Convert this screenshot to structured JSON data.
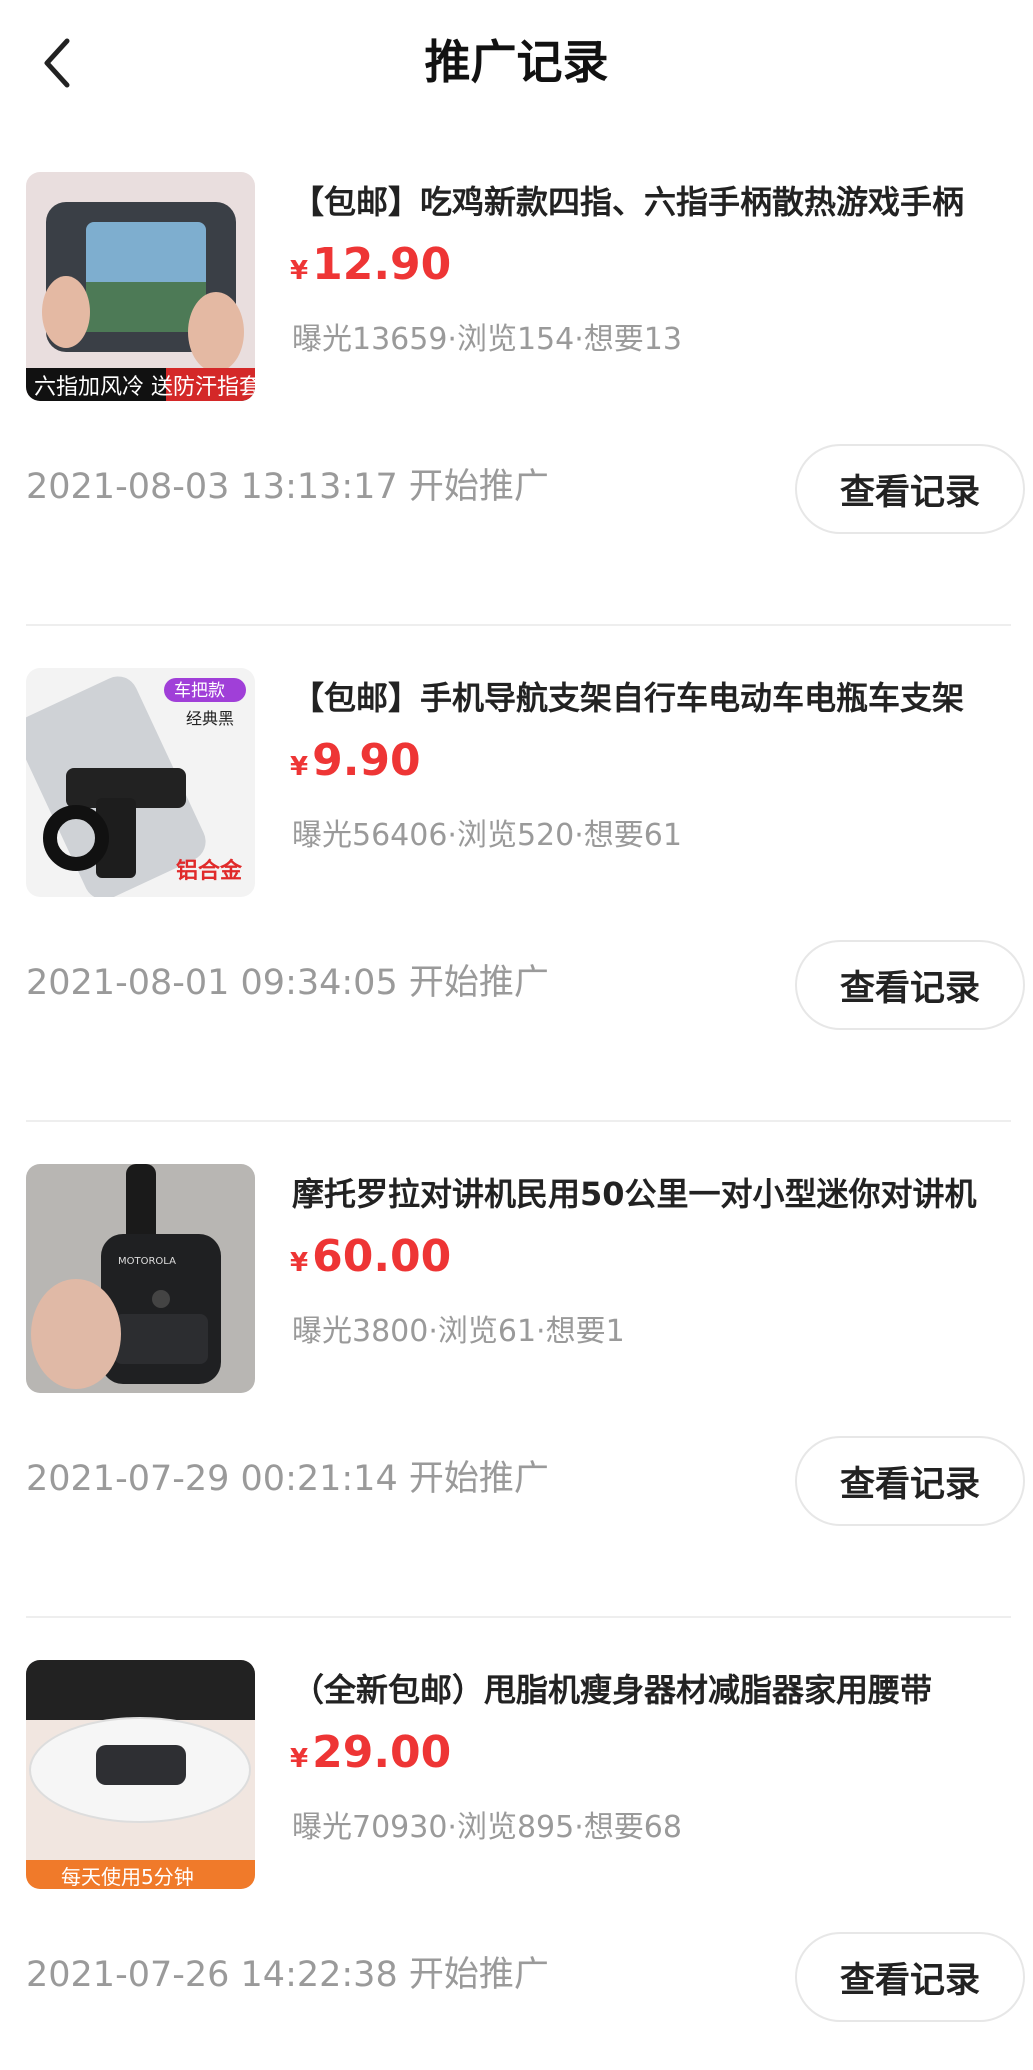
{
  "header": {
    "title": "推广记录"
  },
  "items": [
    {
      "title": "【包邮】吃鸡新款四指、六指手柄散热游戏手柄",
      "currency": "¥",
      "price": "12.90",
      "stats": "曝光13659·浏览154·想要13",
      "date": "2021-08-03 13:13:17 开始推广",
      "button": "查看记录",
      "thumb_label": "六指加风冷 送防汗指套"
    },
    {
      "title": "【包邮】手机导航支架自行车电动车电瓶车支架",
      "currency": "¥",
      "price": "9.90",
      "stats": "曝光56406·浏览520·想要61",
      "date": "2021-08-01 09:34:05 开始推广",
      "button": "查看记录",
      "thumb_badge": "车把款",
      "thumb_sub": "经典黑",
      "thumb_label": "铝合金"
    },
    {
      "title": "摩托罗拉对讲机民用50公里一对小型迷你对讲机",
      "currency": "¥",
      "price": "60.00",
      "stats": "曝光3800·浏览61·想要1",
      "date": "2021-07-29 00:21:14 开始推广",
      "button": "查看记录",
      "thumb_label": "MOTOROLA"
    },
    {
      "title": "（全新包邮）甩脂机瘦身器材减脂器家用腰带",
      "currency": "¥",
      "price": "29.00",
      "stats": "曝光70930·浏览895·想要68",
      "date": "2021-07-26 14:22:38 开始推广",
      "button": "查看记录",
      "thumb_label": "每天使用5分钟"
    }
  ]
}
